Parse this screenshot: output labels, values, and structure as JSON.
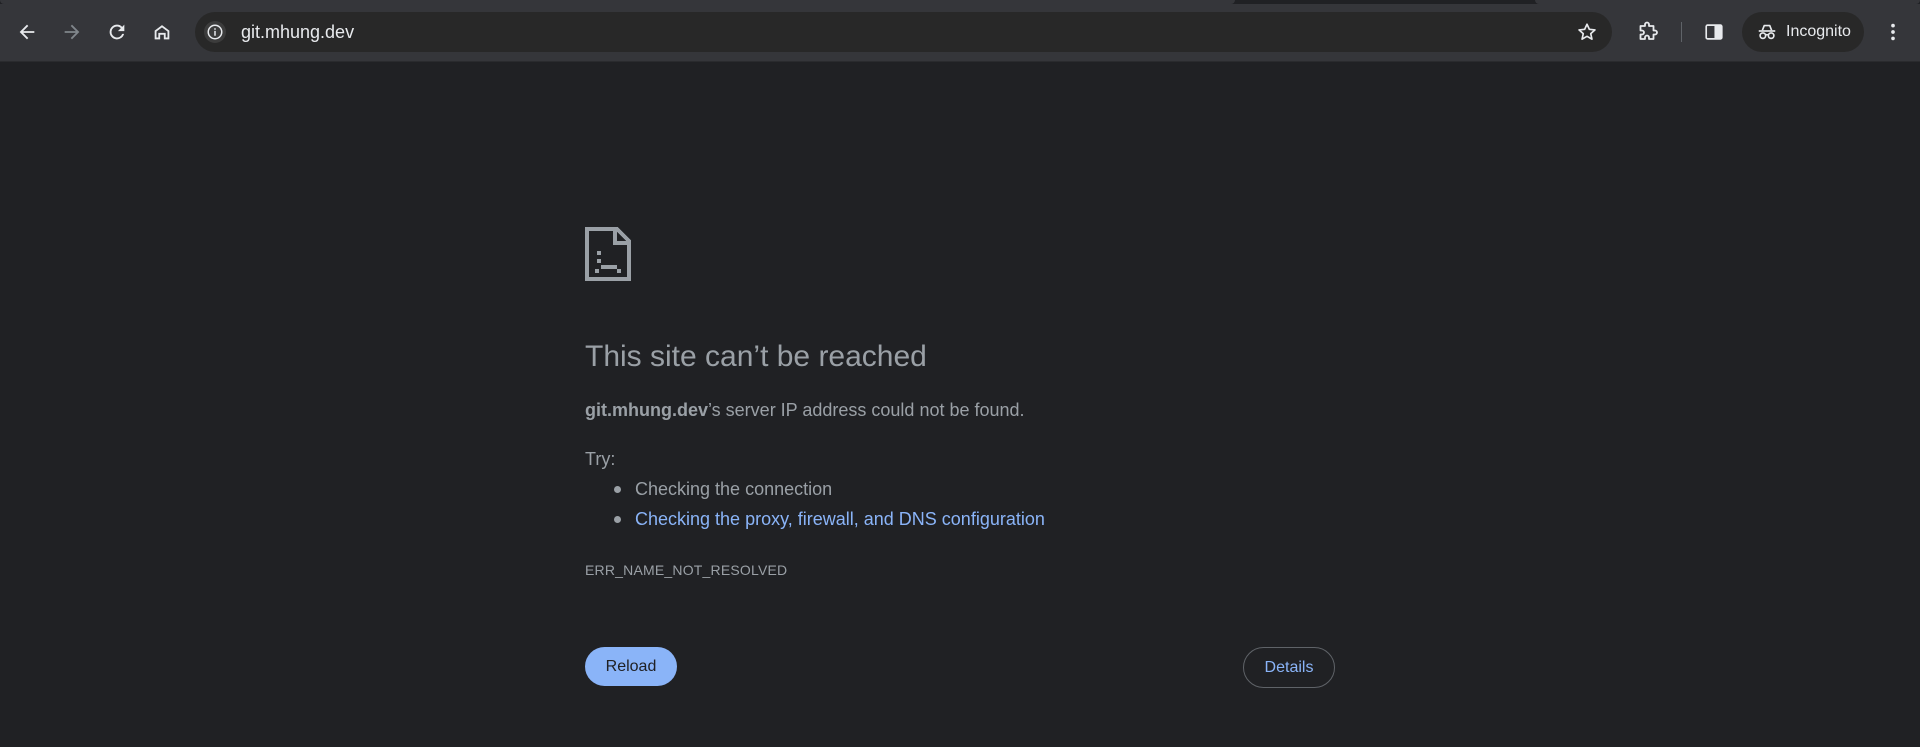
{
  "browser": {
    "address_bar": {
      "url": "git.mhung.dev"
    },
    "icons": {
      "back": "arrow-left-icon",
      "forward": "arrow-right-icon",
      "reload": "reload-icon",
      "home": "home-icon",
      "site_info": "info-icon",
      "bookmark": "star-icon",
      "extensions": "puzzle-icon",
      "side_panel": "side-panel-icon",
      "incognito": "incognito-icon",
      "menu": "kebab-menu-icon"
    },
    "incognito_label": "Incognito"
  },
  "error_page": {
    "headline": "This site can’t be reached",
    "description": {
      "host": "git.mhung.dev",
      "suffix": "’s server IP address could not be found."
    },
    "try_label": "Try:",
    "suggestions": [
      "Checking the connection",
      "Checking the proxy, firewall, and DNS configuration"
    ],
    "error_code": "ERR_NAME_NOT_RESOLVED",
    "buttons": {
      "reload": "Reload",
      "details": "Details"
    }
  },
  "colors": {
    "page_background": "#202124",
    "toolbar_background": "#35363a",
    "text_secondary": "#9aa0a6",
    "link": "#8ab4f8",
    "primary_button": "#8ab4f8"
  }
}
